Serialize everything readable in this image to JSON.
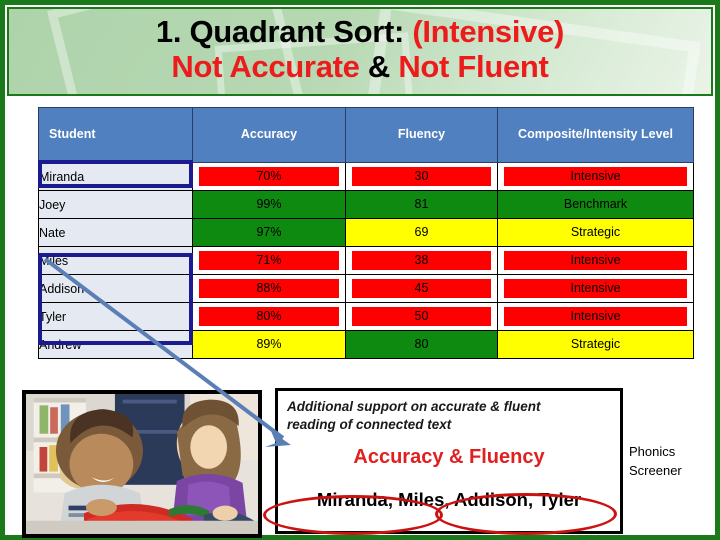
{
  "header": {
    "title_line1_black": "1. Quadrant Sort: ",
    "title_line1_red": "(Intensive)",
    "title_line2_red_a": "Not Accurate ",
    "title_line2_black": "& ",
    "title_line2_red_b": "Not Fluent"
  },
  "table": {
    "columns": [
      "Student",
      "Accuracy",
      "Fluency",
      "Composite/Intensity Level"
    ],
    "rows": [
      {
        "student": "Miranda",
        "accuracy": "70%",
        "fluency": "30",
        "composite": "Intensive",
        "accuracy_color": "red",
        "fluency_color": "red",
        "composite_color": "red"
      },
      {
        "student": "Joey",
        "accuracy": "99%",
        "fluency": "81",
        "composite": "Benchmark",
        "accuracy_color": "green",
        "fluency_color": "green",
        "composite_color": "green"
      },
      {
        "student": "Nate",
        "accuracy": "97%",
        "fluency": "69",
        "composite": "Strategic",
        "accuracy_color": "green",
        "fluency_color": "yellow",
        "composite_color": "yellow"
      },
      {
        "student": "Miles",
        "accuracy": "71%",
        "fluency": "38",
        "composite": "Intensive",
        "accuracy_color": "red",
        "fluency_color": "red",
        "composite_color": "red"
      },
      {
        "student": "Addison",
        "accuracy": "88%",
        "fluency": "45",
        "composite": "Intensive",
        "accuracy_color": "red",
        "fluency_color": "red",
        "composite_color": "red"
      },
      {
        "student": "Tyler",
        "accuracy": "80%",
        "fluency": "50",
        "composite": "Intensive",
        "accuracy_color": "red",
        "fluency_color": "red",
        "composite_color": "red"
      },
      {
        "student": "Andrew",
        "accuracy": "89%",
        "fluency": "80",
        "composite": "Strategic",
        "accuracy_color": "yellow",
        "fluency_color": "green",
        "composite_color": "yellow"
      }
    ]
  },
  "callout": {
    "subtext": "Additional support on accurate & fluent reading of connected text",
    "title": "Accuracy & Fluency",
    "names": "Miranda, Miles, Addison, Tyler"
  },
  "phonics": {
    "line1": "Phonics",
    "line2": "Screener"
  },
  "colors": {
    "red": "#fe0000",
    "green": "#0e8a10",
    "yellow": "#ffff00",
    "header_blue": "#5080bf",
    "navy_highlight": "#1b1b8f",
    "banner_green_border": "#1a7a1a",
    "title_red": "#ec1c1c",
    "ellipse_red": "#cc1111",
    "arrow_blue": "#5b7fb5"
  }
}
